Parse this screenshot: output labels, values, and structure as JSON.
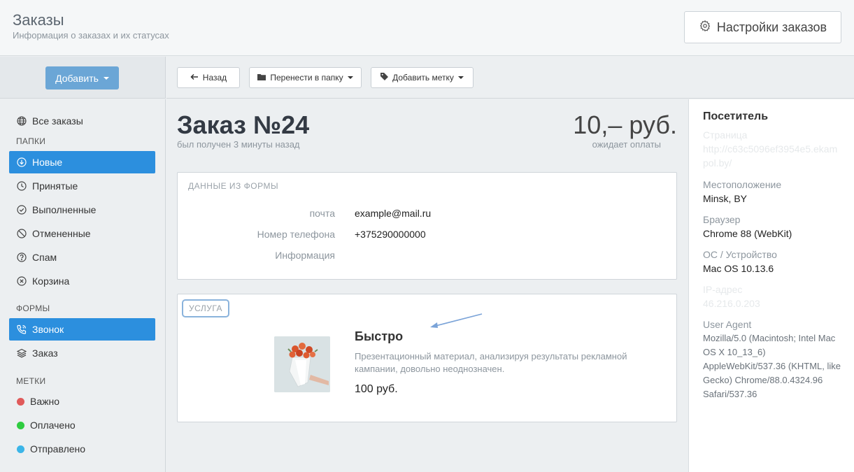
{
  "header": {
    "title": "Заказы",
    "subtitle": "Информация о заказах и их статусах",
    "settings_label": "Настройки заказов"
  },
  "toolbar": {
    "add_label": "Добавить",
    "back_label": "Назад",
    "move_label": "Перенести в папку",
    "tag_label": "Добавить метку"
  },
  "sidebar": {
    "all_orders": "Все заказы",
    "folders_heading": "ПАПКИ",
    "folders": [
      "Новые",
      "Принятые",
      "Выполненные",
      "Отмененные",
      "Спам",
      "Корзина"
    ],
    "forms_heading": "ФОРМЫ",
    "forms": [
      "Звонок",
      "Заказ"
    ],
    "tags_heading": "МЕТКИ",
    "tags": [
      {
        "label": "Важно",
        "color": "#e05a5a"
      },
      {
        "label": "Оплачено",
        "color": "#2ecc40"
      },
      {
        "label": "Отправлено",
        "color": "#3bb5e8"
      }
    ]
  },
  "order": {
    "title": "Заказ №24",
    "received": "был получен 3 минуты назад",
    "price": "10,– руб.",
    "status": "ожидает оплаты"
  },
  "form_data": {
    "heading": "ДАННЫЕ ИЗ ФОРМЫ",
    "rows": [
      {
        "key": "почта",
        "value": "example@mail.ru"
      },
      {
        "key": "Номер телефона",
        "value": "+375290000000"
      },
      {
        "key": "Информация",
        "value": ""
      }
    ]
  },
  "service": {
    "badge": "УСЛУГА",
    "title": "Быстро",
    "description": "Презентационный материал, анализируя результаты рекламной кампании, довольно неоднозначен.",
    "price": "100 руб."
  },
  "visitor": {
    "title": "Посетитель",
    "page_key": "Страница",
    "page_value": "http://c63c5096ef3954e5.ekam pol.by/",
    "location_key": "Местоположение",
    "location_value": "Minsk, BY",
    "browser_key": "Браузер",
    "browser_value": "Chrome 88 (WebKit)",
    "os_key": "ОС / Устройство",
    "os_value": "Mac OS 10.13.6",
    "ip_key": "IP-адрес",
    "ip_value": "46.216.0.203",
    "ua_key": "User Agent",
    "ua_value": "Mozilla/5.0 (Macintosh; Intel Mac OS X 10_13_6) AppleWebKit/537.36 (KHTML, like Gecko) Chrome/88.0.4324.96 Safari/537.36"
  },
  "colors": {
    "accent": "#2c8fde",
    "add_button": "#6ba6d6"
  }
}
